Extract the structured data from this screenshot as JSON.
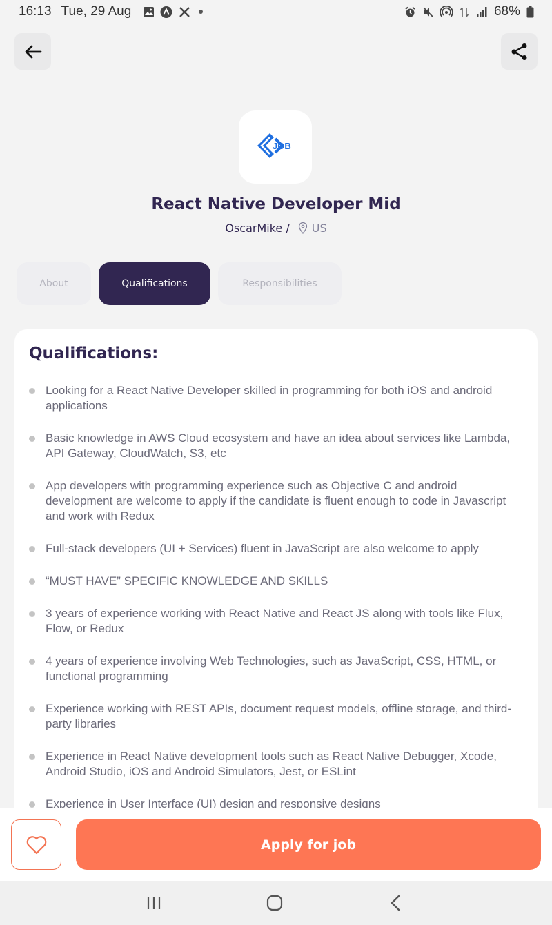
{
  "status_bar": {
    "time": "16:13",
    "date": "Tue, 29 Aug",
    "battery": "68%",
    "left_icons": [
      "gallery-icon",
      "app-icon",
      "x-icon"
    ],
    "right_icons": [
      "alarm-icon",
      "mute-icon",
      "hotspot-icon",
      "data-icon",
      "signal-icon",
      "battery-icon"
    ]
  },
  "header": {
    "back_icon": "arrow-left-icon",
    "share_icon": "share-icon"
  },
  "job": {
    "logo_text": "JOB",
    "title": "React Native Developer Mid",
    "company": "OscarMike /",
    "location": "US"
  },
  "tabs": [
    {
      "label": "About",
      "active": false
    },
    {
      "label": "Qualifications",
      "active": true
    },
    {
      "label": "Responsibilities",
      "active": false
    }
  ],
  "qualifications": {
    "heading": "Qualifications:",
    "items": [
      "Looking for a React Native Developer skilled in programming for both iOS and android applications",
      "Basic knowledge in AWS Cloud ecosystem and have an idea about services like Lambda, API Gateway, CloudWatch, S3, etc",
      "App developers with programming experience such as Objective C and android development are welcome to apply if the candidate is fluent enough to code in Javascript and work with Redux",
      "Full-stack developers (UI + Services) fluent in JavaScript are also welcome to apply",
      "“MUST HAVE” SPECIFIC KNOWLEDGE AND SKILLS",
      "3 years of experience working with React Native and React JS along with tools like Flux, Flow, or Redux",
      "4 years of experience involving Web Technologies, such as JavaScript, CSS, HTML, or functional programming",
      "Experience working with REST APIs, document request models, offline storage, and third-party libraries",
      "Experience in React Native development tools such as React Native Debugger, Xcode, Android Studio, iOS and Android Simulators, Jest, or ESLint",
      "Experience in User Interface (UI) design and responsive designs"
    ]
  },
  "footer": {
    "like_icon": "heart-icon",
    "apply_label": "Apply for job"
  },
  "nav_bar": {
    "recent_icon": "recent-apps-icon",
    "home_icon": "home-icon",
    "back_icon": "nav-back-icon"
  },
  "colors": {
    "primary": "#312651",
    "accent": "#fe7654",
    "background": "#f3f3f3",
    "muted_text": "#83829a"
  }
}
